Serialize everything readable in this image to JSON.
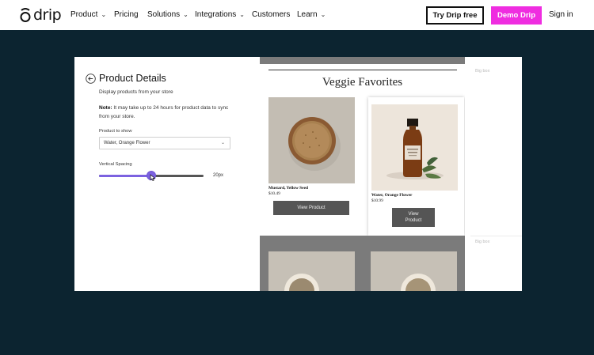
{
  "nav": {
    "logo_text": "drip",
    "items": [
      {
        "label": "Product",
        "dropdown": true
      },
      {
        "label": "Pricing",
        "dropdown": false
      },
      {
        "label": "Solutions",
        "dropdown": true
      },
      {
        "label": "Integrations",
        "dropdown": true
      },
      {
        "label": "Customers",
        "dropdown": false
      },
      {
        "label": "Learn",
        "dropdown": true
      }
    ],
    "try_label": "Try Drip free",
    "demo_label": "Demo Drip",
    "signin_label": "Sign in",
    "demo_color": "#ef2de0"
  },
  "settings": {
    "title": "Product Details",
    "subtitle": "Display products from your store",
    "note_bold": "Note:",
    "note_text": "It may take up to 24 hours for product data to sync from your store.",
    "product_label": "Product to show",
    "product_value": "Water, Orange Flower",
    "spacing_label": "Vertical Spacing",
    "spacing_value": "20px",
    "spacing_fraction": 0.5,
    "accent_color": "#7c62e0"
  },
  "preview": {
    "heading": "Veggie Favorites",
    "products": [
      {
        "name": "Mustard, Yellow Seed",
        "price": "$10.49",
        "button": "View Product"
      },
      {
        "name": "Water, Orange Flower",
        "price": "$10.99",
        "button": "View Product"
      }
    ]
  },
  "right": {
    "box_label_1": "Big box",
    "box_label_2": "Big box"
  }
}
